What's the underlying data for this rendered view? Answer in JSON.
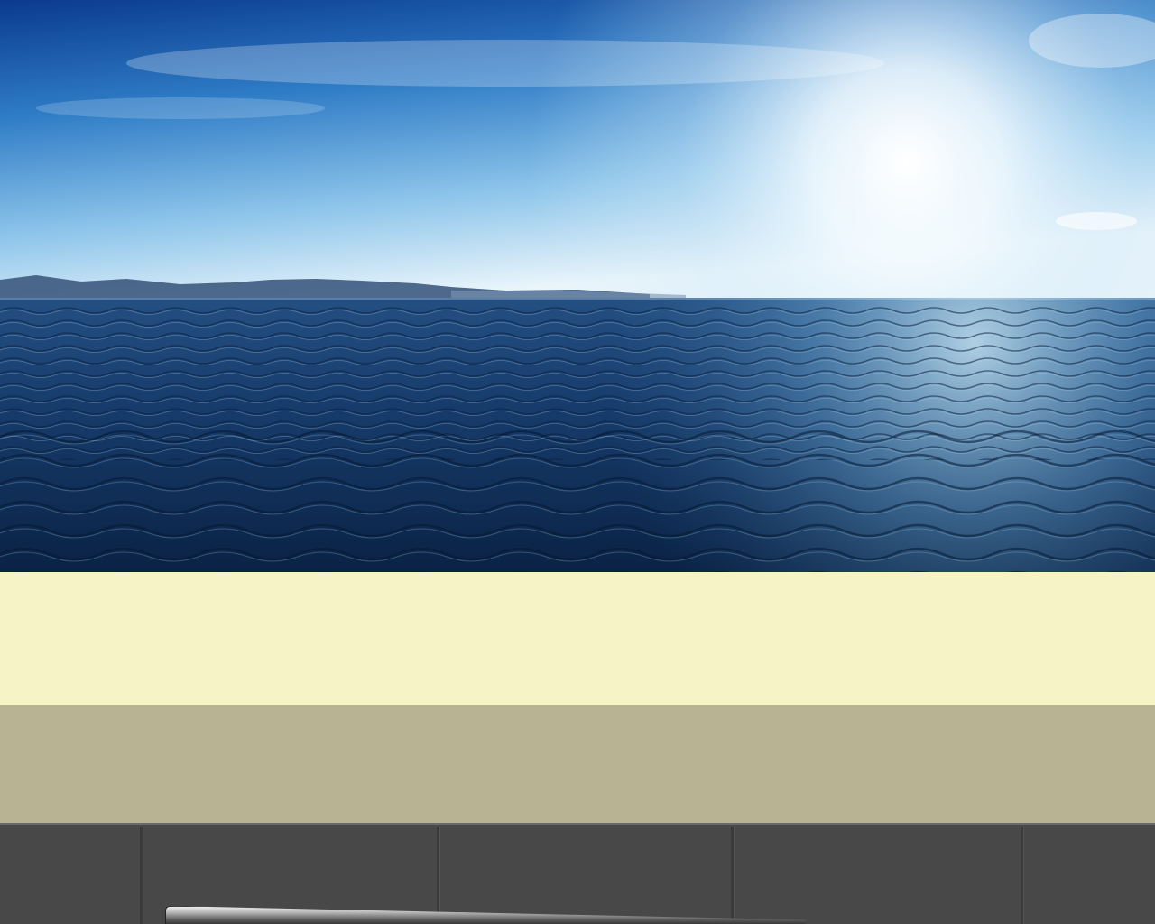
{
  "colors": {
    "sky_top": "#0d3f95",
    "sky_mid": "#3f8fd4",
    "sky_horizon": "#e8f4fb",
    "sun_glow": "#ffffff",
    "mountains": "#3d5a80",
    "sea_far": "#2a5a8c",
    "sea_near": "#0b2548",
    "sea_glint": "#9fd0ea",
    "band_cream": "#f6f4c6",
    "band_khaki": "#b7b393",
    "taskbar": "#484848"
  },
  "hero": {
    "icon": "seascape-image"
  },
  "taskbar": {
    "cells": [
      {
        "name": "taskbar-cell-1"
      },
      {
        "name": "taskbar-cell-2"
      },
      {
        "name": "taskbar-cell-3"
      },
      {
        "name": "taskbar-cell-4"
      },
      {
        "name": "taskbar-cell-5"
      }
    ]
  }
}
